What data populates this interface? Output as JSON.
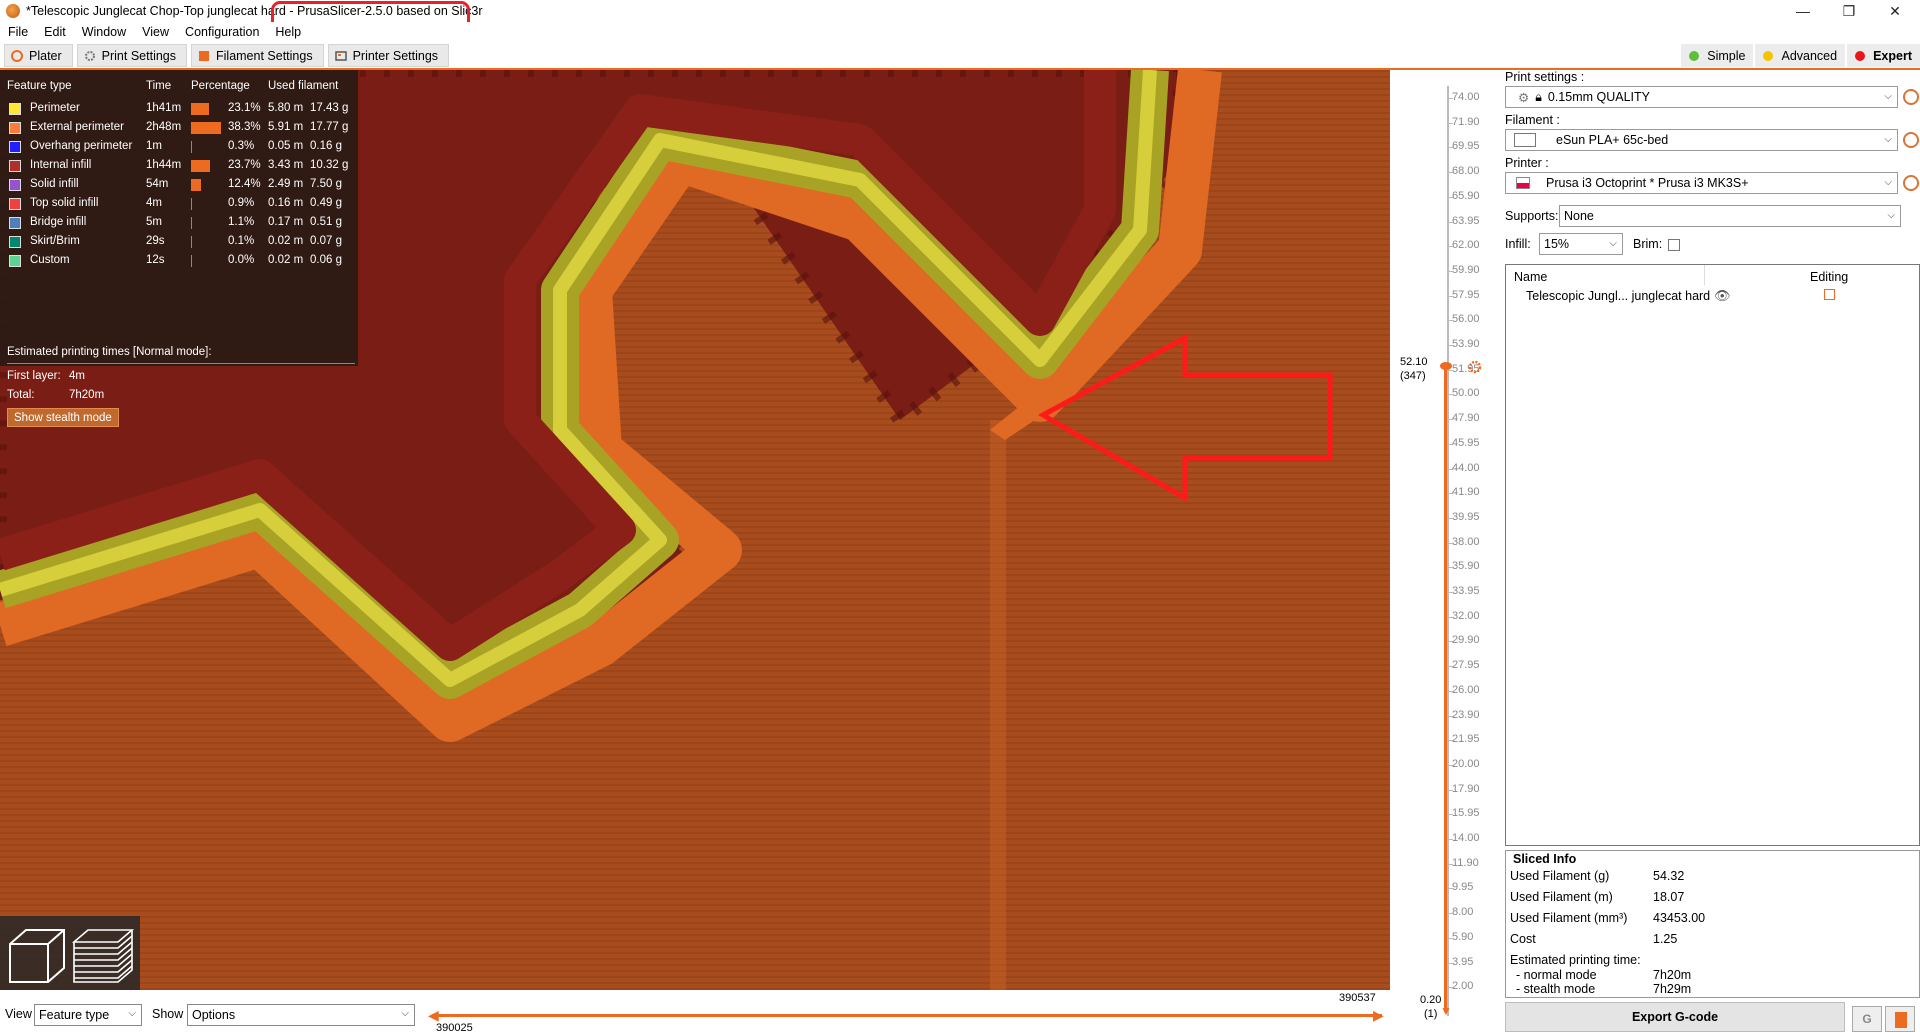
{
  "window": {
    "title_prefix": "*Telescopic Junglecat Chop-Top junglecat hard ",
    "title_app": "- PrusaSlicer-2.5.0 based on Slic3r",
    "minimize": "—",
    "maximize": "❐",
    "close": "✕"
  },
  "menu": [
    "File",
    "Edit",
    "Window",
    "View",
    "Configuration",
    "Help"
  ],
  "tabs": [
    {
      "label": "Plater",
      "icon": "plater-icon"
    },
    {
      "label": "Print Settings",
      "icon": "gear-icon"
    },
    {
      "label": "Filament Settings",
      "icon": "spool-icon"
    },
    {
      "label": "Printer Settings",
      "icon": "printer-icon"
    }
  ],
  "modes": [
    {
      "label": "Simple",
      "color": "#5fbf3a"
    },
    {
      "label": "Advanced",
      "color": "#f5c400"
    },
    {
      "label": "Expert",
      "color": "#e8171c"
    }
  ],
  "legend": {
    "headers": [
      "Feature type",
      "Time",
      "Percentage",
      "Used filament"
    ],
    "rows": [
      {
        "name": "Perimeter",
        "color": "#ffe633",
        "time": "1h41m",
        "pct": "23.1%",
        "pct_value": 23.1,
        "len": "5.80 m",
        "weight": "17.43 g"
      },
      {
        "name": "External perimeter",
        "color": "#ff7d38",
        "time": "2h48m",
        "pct": "38.3%",
        "pct_value": 38.3,
        "len": "5.91 m",
        "weight": "17.77 g"
      },
      {
        "name": "Overhang perimeter",
        "color": "#1f1fff",
        "time": "1m",
        "pct": "0.3%",
        "pct_value": 0.3,
        "len": "0.05 m",
        "weight": "0.16 g"
      },
      {
        "name": "Internal infill",
        "color": "#b03029",
        "time": "1h44m",
        "pct": "23.7%",
        "pct_value": 23.7,
        "len": "3.43 m",
        "weight": "10.32 g"
      },
      {
        "name": "Solid infill",
        "color": "#9654cc",
        "time": "54m",
        "pct": "12.4%",
        "pct_value": 12.4,
        "len": "2.49 m",
        "weight": "7.50 g"
      },
      {
        "name": "Top solid infill",
        "color": "#f04040",
        "time": "4m",
        "pct": "0.9%",
        "pct_value": 0.9,
        "len": "0.16 m",
        "weight": "0.49 g"
      },
      {
        "name": "Bridge infill",
        "color": "#4d80ba",
        "time": "5m",
        "pct": "1.1%",
        "pct_value": 1.1,
        "len": "0.17 m",
        "weight": "0.51 g"
      },
      {
        "name": "Skirt/Brim",
        "color": "#00876e",
        "time": "29s",
        "pct": "0.1%",
        "pct_value": 0.1,
        "len": "0.02 m",
        "weight": "0.07 g"
      },
      {
        "name": "Custom",
        "color": "#5ed194",
        "time": "12s",
        "pct": "0.0%",
        "pct_value": 0.0,
        "len": "0.02 m",
        "weight": "0.06 g"
      }
    ],
    "est_title": "Estimated printing times [Normal mode]:",
    "first_layer_label": "First layer:",
    "first_layer_value": "4m",
    "total_label": "Total:",
    "total_value": "7h20m",
    "stealth_button": "Show stealth mode"
  },
  "bottom": {
    "view_label": "View",
    "view_value": "Feature type",
    "show_label": "Show",
    "show_value": "Options",
    "hslider_right": "390537",
    "hslider_left": "390025"
  },
  "vslider": {
    "ticks": [
      "74.00",
      "71.90",
      "69.95",
      "68.00",
      "65.90",
      "63.95",
      "62.00",
      "59.90",
      "57.95",
      "56.00",
      "53.90",
      "51.95",
      "50.00",
      "47.90",
      "45.95",
      "44.00",
      "41.90",
      "39.95",
      "38.00",
      "35.90",
      "33.95",
      "32.00",
      "29.90",
      "27.95",
      "26.00",
      "23.90",
      "21.95",
      "20.00",
      "17.90",
      "15.95",
      "14.00",
      "11.90",
      "9.95",
      "8.00",
      "5.90",
      "3.95",
      "2.00"
    ],
    "current_height": "52.10",
    "current_layer": "(347)",
    "bottom_height": "0.20",
    "bottom_layer": "(1)"
  },
  "sidebar": {
    "print_settings_label": "Print settings :",
    "print_settings_value": "0.15mm QUALITY",
    "filament_label": "Filament :",
    "filament_value": "eSun PLA+ 65c-bed",
    "printer_label": "Printer :",
    "printer_value": "Prusa i3 Octoprint * Prusa i3 MK3S+",
    "supports_label": "Supports:",
    "supports_value": "None",
    "infill_label": "Infill:",
    "infill_value": "15%",
    "brim_label": "Brim:",
    "col_name": "Name",
    "col_editing": "Editing",
    "object_name": "Telescopic Jungl... junglecat hard"
  },
  "sliced_info": {
    "title": "Sliced Info",
    "rows": [
      {
        "label": "Used Filament (g)",
        "value": "54.32"
      },
      {
        "label": "Used Filament (m)",
        "value": "18.07"
      },
      {
        "label": "Used Filament (mm³)",
        "value": "43453.00"
      },
      {
        "label": "Cost",
        "value": "1.25"
      }
    ],
    "est_label": "Estimated printing time:",
    "normal_label": "- normal mode",
    "normal_value": "7h20m",
    "stealth_label": "- stealth mode",
    "stealth_value": "7h29m"
  },
  "export_button": "Export G-code"
}
